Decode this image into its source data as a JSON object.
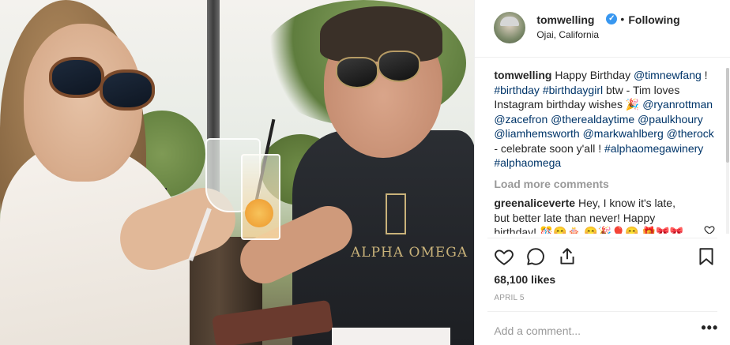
{
  "post": {
    "username": "tomwelling",
    "separator": "•",
    "follow_status": "Following",
    "location": "Ojai, California",
    "caption": {
      "author": "tomwelling",
      "text_1": " Happy Birthday ",
      "mention_1": "@timnewfang",
      "text_2": " ! ",
      "hashtag_1": "#birthday",
      "text_3": " ",
      "hashtag_2": "#birthdaygirl",
      "text_4": " btw - Tim loves Instagram birthday wishes 🎉 ",
      "mentions": [
        "@ryanrottman",
        "@zacefron",
        "@therealdaytime",
        "@paulkhoury",
        "@liamhemsworth",
        "@markwahlberg",
        "@therock"
      ],
      "text_5": " - celebrate soon y'all ! ",
      "hashtag_3": "#alphaomegawinery",
      "hashtag_4": "#alphaomega"
    },
    "load_more": "Load more comments",
    "comment": {
      "author": "greenaliceverte",
      "text": " Hey, I know it's late, but better late than never! Happy birthday! 🎊😊🎂 😊🎉🎈😊 🎁🎀🎀🍸🍸🍹"
    },
    "likes": "68,100 likes",
    "date": "APRIL 5",
    "add_comment_placeholder": "Add a comment...",
    "more_options": "•••",
    "photo_text": {
      "shirt_print": "ALPHA OMEGA",
      "logo_letters": "A Ω"
    }
  },
  "icons": {
    "like": "heart-icon",
    "comment": "comment-bubble-icon",
    "share": "share-icon",
    "save": "bookmark-icon",
    "verified": "verified-badge-icon",
    "comment_like": "small-heart-icon"
  },
  "colors": {
    "link": "#003569",
    "verified": "#3897f0",
    "muted": "#999999",
    "text": "#262626"
  }
}
